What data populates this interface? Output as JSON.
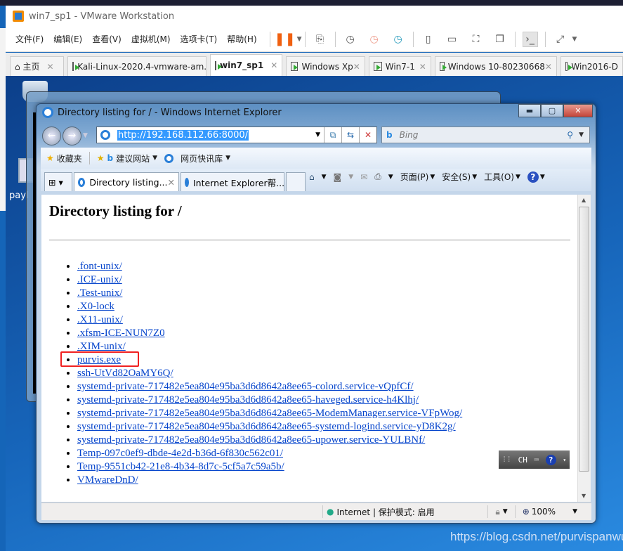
{
  "vmware": {
    "title": "win7_sp1 - VMware Workstation",
    "menu": [
      "文件(F)",
      "编辑(E)",
      "查看(V)",
      "虚拟机(M)",
      "选项卡(T)",
      "帮助(H)"
    ],
    "tabs": [
      {
        "label": "主页",
        "icon": "home-icon"
      },
      {
        "label": "Kali-Linux-2020.4-vmware-am..."
      },
      {
        "label": "win7_sp1",
        "active": true
      },
      {
        "label": "Windows Xp"
      },
      {
        "label": "Win7-1"
      },
      {
        "label": "Windows 10-80230668"
      },
      {
        "label": "Win2016-D"
      }
    ]
  },
  "ie": {
    "title": "Directory listing for / - Windows Internet Explorer",
    "url": "http://192.168.112.66:8000/",
    "search_placeholder": "Bing",
    "favorites": "收藏夹",
    "suggested": "建议网站",
    "webslice": "网页快讯库",
    "tabs": [
      "Directory listing...",
      "Internet Explorer帮..."
    ],
    "commands": {
      "page": "页面(P)",
      "safety": "安全(S)",
      "tools": "工具(O)"
    },
    "status": {
      "zone": "Internet | 保护模式: 启用",
      "zoom": "100%"
    },
    "ime": "CH"
  },
  "page": {
    "heading": "Directory listing for /",
    "items": [
      ".font-unix/",
      ".ICE-unix/",
      ".Test-unix/",
      ".X0-lock",
      ".X11-unix/",
      ".xfsm-ICE-NUN7Z0",
      ".XIM-unix/",
      "purvis.exe",
      "ssh-UtVd82OaMY6Q/",
      "systemd-private-717482e5ea804e95ba3d6d8642a8ee65-colord.service-vQpfCf/",
      "systemd-private-717482e5ea804e95ba3d6d8642a8ee65-haveged.service-h4Klhj/",
      "systemd-private-717482e5ea804e95ba3d6d8642a8ee65-ModemManager.service-VFpWog/",
      "systemd-private-717482e5ea804e95ba3d6d8642a8ee65-systemd-logind.service-yD8K2g/",
      "systemd-private-717482e5ea804e95ba3d6d8642a8ee65-upower.service-YULBNf/",
      "Temp-097c0ef9-dbde-4e2d-b36d-6f830c562c01/",
      "Temp-9551cb42-21e8-4b34-8d7c-5cf5a7c59a5b/",
      "VMwareDnD/"
    ],
    "highlighted": "purvis.exe",
    "highlight_color": "#f02020"
  },
  "desktop": {
    "icon_label": "payl"
  },
  "watermark": "https://blog.csdn.net/purvispanwu"
}
